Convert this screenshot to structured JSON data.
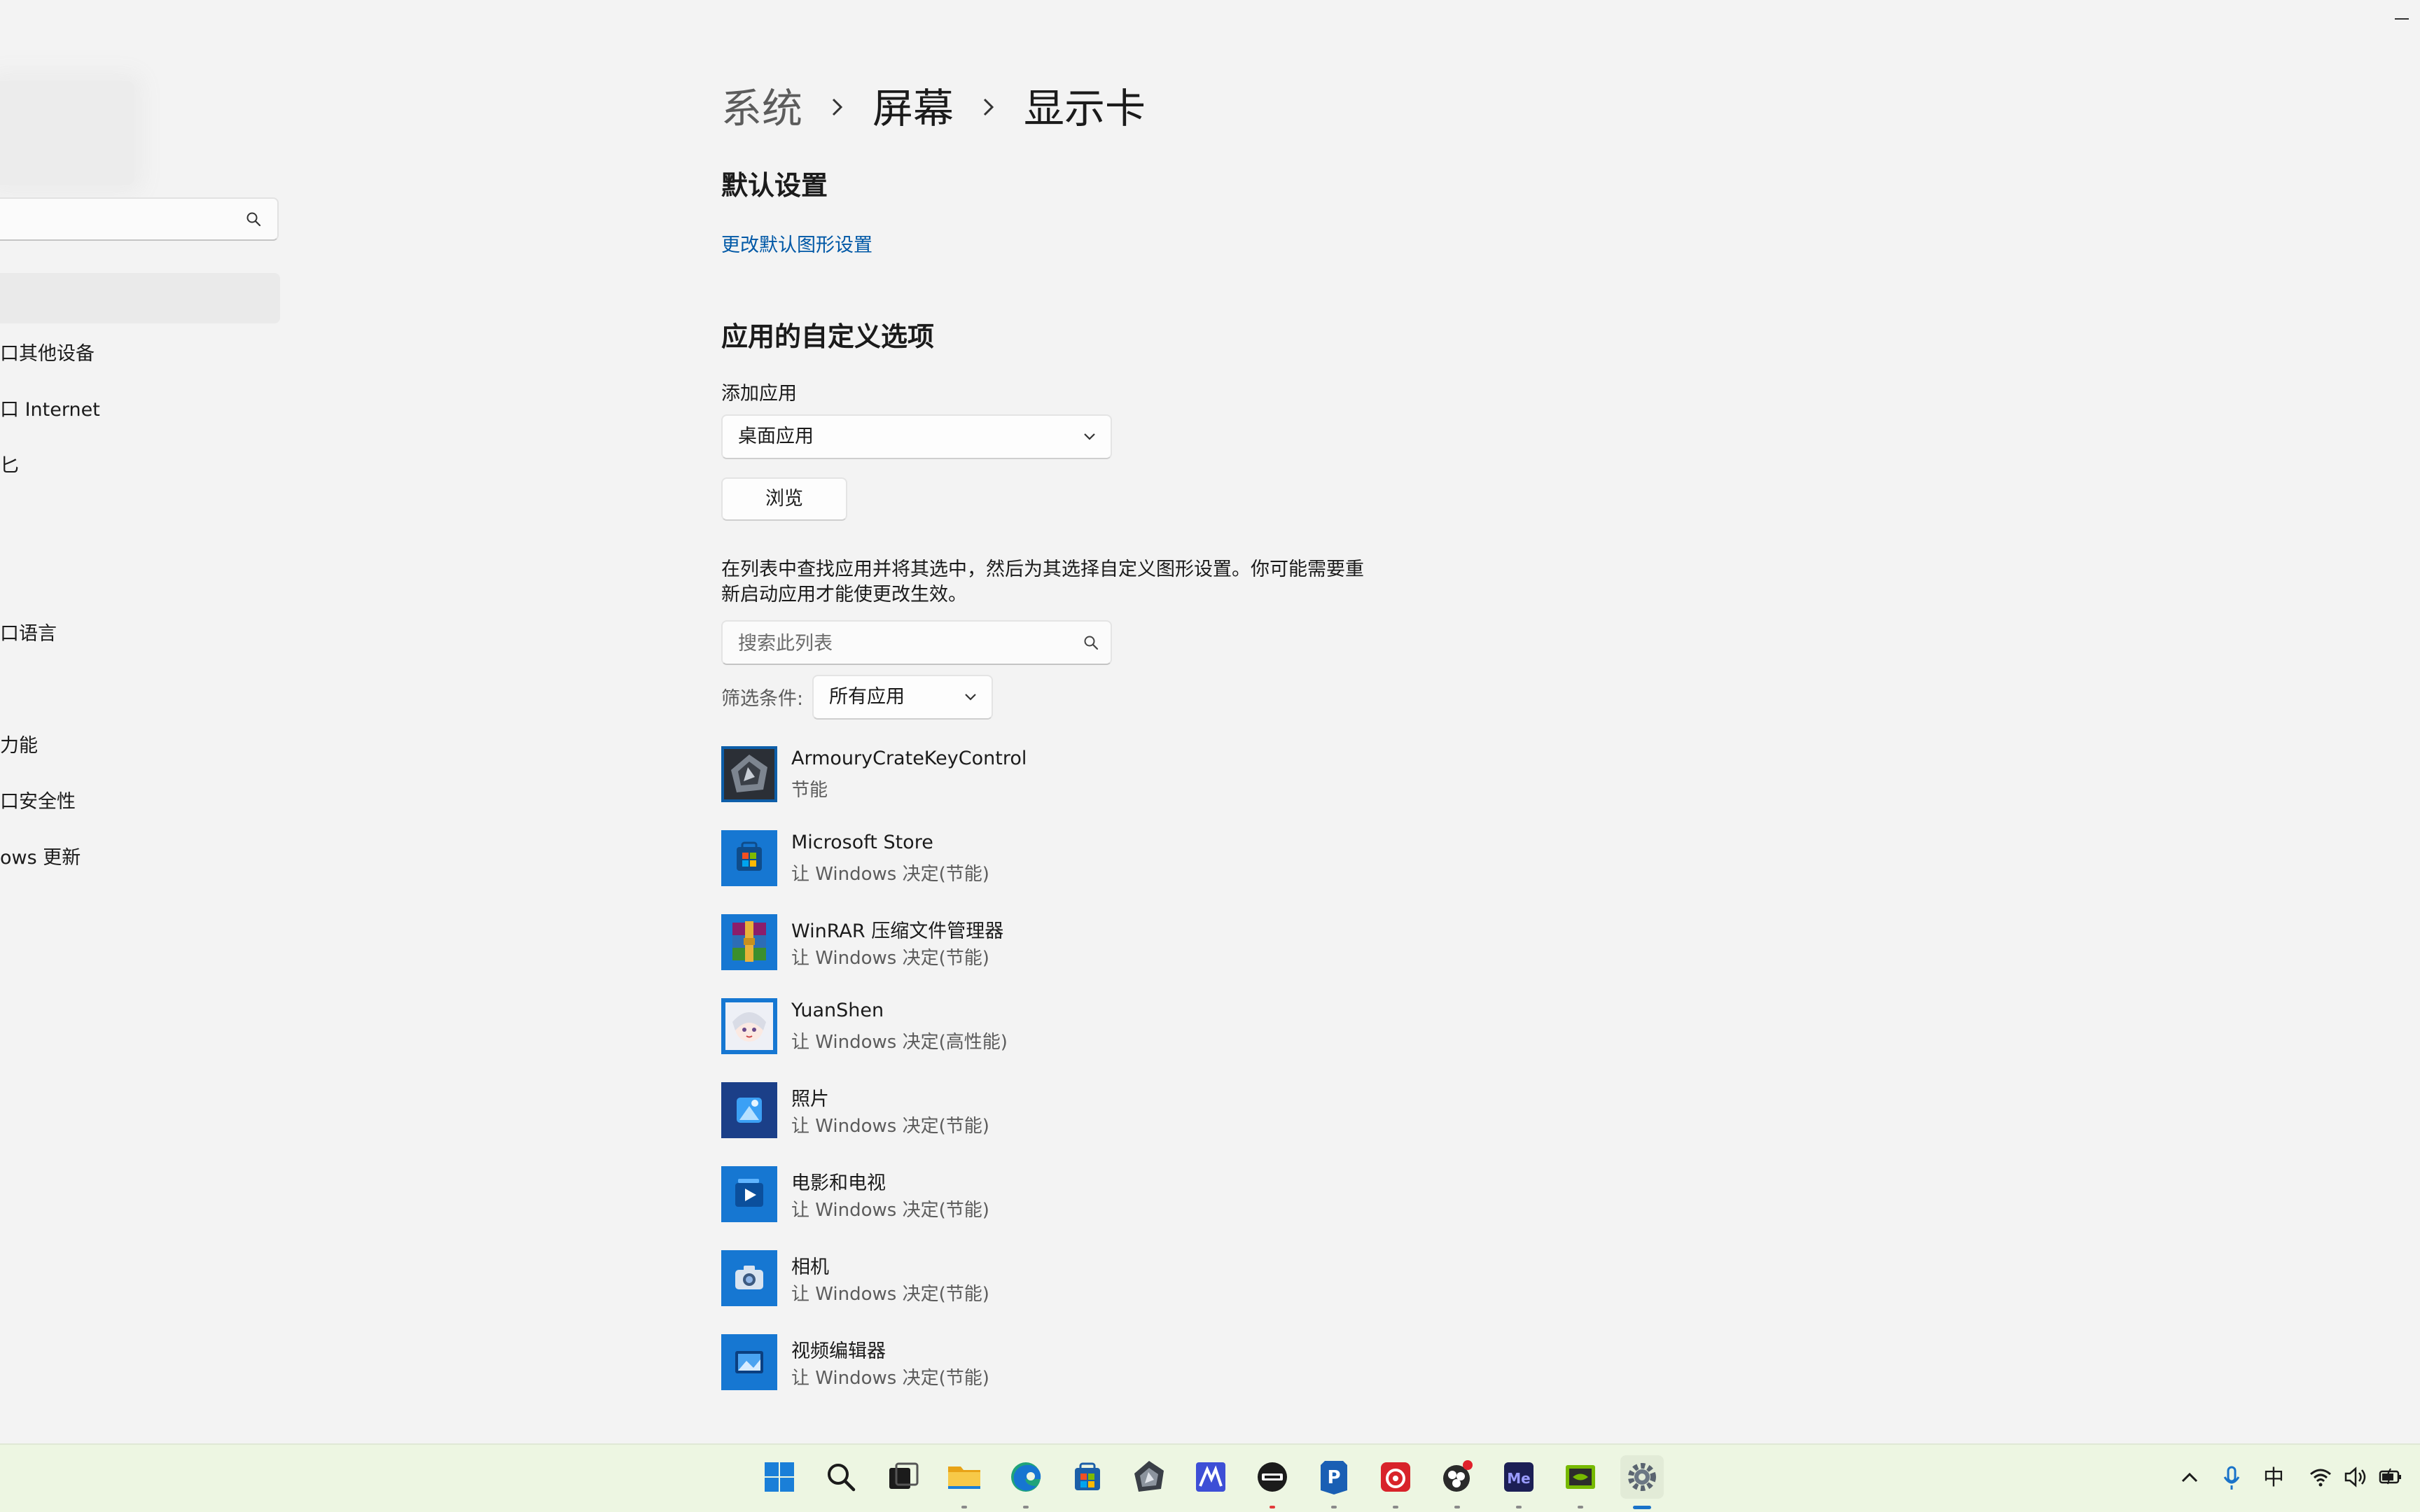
{
  "window": {
    "minimize_label": "—"
  },
  "sidebar": {
    "search_placeholder": "",
    "items": [
      {
        "label": "口其他设备"
      },
      {
        "label": "口 Internet"
      },
      {
        "label": "匕"
      },
      {
        "label": "口语言"
      },
      {
        "label": "力能"
      },
      {
        "label": "口安全性"
      },
      {
        "label": "ows 更新"
      }
    ]
  },
  "breadcrumb": {
    "level1": "系统",
    "level2": "屏幕",
    "level3": "显示卡",
    "separator": "›"
  },
  "default_settings": {
    "heading": "默认设置",
    "link": "更改默认图形设置"
  },
  "custom_options": {
    "heading": "应用的自定义选项",
    "add_app_label": "添加应用",
    "app_type_selected": "桌面应用",
    "browse_button": "浏览",
    "description": "在列表中查找应用并将其选中，然后为其选择自定义图形设置。你可能需要重新启动应用才能使更改生效。",
    "search_placeholder": "搜索此列表",
    "filter_label": "筛选条件:",
    "filter_selected": "所有应用"
  },
  "apps": [
    {
      "name": "ArmouryCrateKeyControl",
      "preference": "节能",
      "icon": "armoury-crate-icon"
    },
    {
      "name": "Microsoft Store",
      "preference": "让 Windows 决定(节能)",
      "icon": "microsoft-store-icon"
    },
    {
      "name": "WinRAR 压缩文件管理器",
      "preference": "让 Windows 决定(节能)",
      "icon": "winrar-icon"
    },
    {
      "name": "YuanShen",
      "preference": "让 Windows 决定(高性能)",
      "icon": "yuanshen-icon"
    },
    {
      "name": "照片",
      "preference": "让 Windows 决定(节能)",
      "icon": "photos-icon"
    },
    {
      "name": "电影和电视",
      "preference": "让 Windows 决定(节能)",
      "icon": "movies-tv-icon"
    },
    {
      "name": "相机",
      "preference": "让 Windows 决定(节能)",
      "icon": "camera-icon"
    },
    {
      "name": "视频编辑器",
      "preference": "让 Windows 决定(节能)",
      "icon": "video-editor-icon"
    }
  ],
  "taskbar": {
    "icons": [
      "start-icon",
      "search-icon",
      "task-view-icon",
      "file-explorer-icon",
      "edge-icon",
      "store-icon",
      "armoury-crate-icon",
      "mathpix-icon",
      "cmd-icon",
      "ppt-p-icon",
      "netease-music-icon",
      "obs-icon",
      "media-encoder-icon",
      "nvidia-icon",
      "settings-icon"
    ],
    "tray": {
      "ime_label": "中",
      "icons": [
        "chevron-up-icon",
        "microphone-icon",
        "wifi-icon",
        "volume-icon",
        "battery-icon"
      ]
    },
    "colors": {
      "active_indicator": "#1a73c9",
      "background": "#edf6e2"
    }
  },
  "colors": {
    "accent_link": "#0058a6",
    "app_icon_bg": "#1677d2",
    "page_bg": "#f3f3f3"
  }
}
